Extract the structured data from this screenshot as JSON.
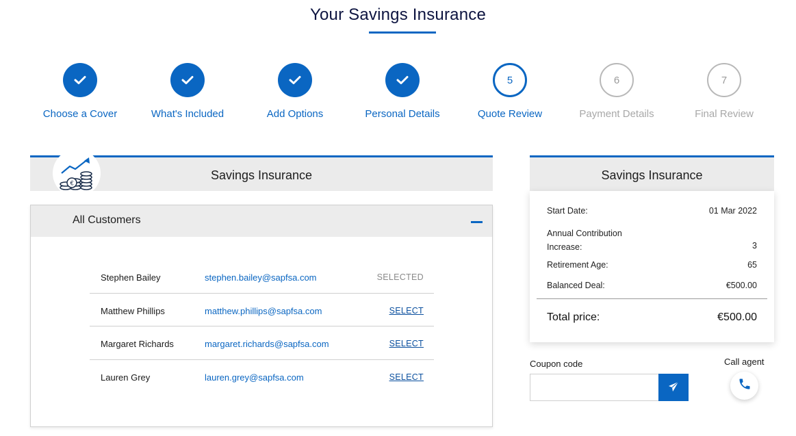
{
  "page": {
    "title": "Your Savings Insurance"
  },
  "stepper": {
    "steps": [
      {
        "number": "1",
        "label": "Choose a Cover",
        "state": "done"
      },
      {
        "number": "2",
        "label": "What's Included",
        "state": "done"
      },
      {
        "number": "3",
        "label": "Add Options",
        "state": "done"
      },
      {
        "number": "4",
        "label": "Personal Details",
        "state": "done"
      },
      {
        "number": "5",
        "label": "Quote Review",
        "state": "current"
      },
      {
        "number": "6",
        "label": "Payment Details",
        "state": "todo"
      },
      {
        "number": "7",
        "label": "Final Review",
        "state": "todo"
      }
    ]
  },
  "product": {
    "title": "Savings Insurance",
    "icon": "savings-growth-icon"
  },
  "customers": {
    "title": "All Customers",
    "rows": [
      {
        "name": "Stephen Bailey",
        "email": "stephen.bailey@sapfsa.com",
        "action": "SELECTED",
        "selected": true
      },
      {
        "name": "Matthew Phillips",
        "email": "matthew.phillips@sapfsa.com",
        "action": "SELECT",
        "selected": false
      },
      {
        "name": "Margaret Richards",
        "email": "margaret.richards@sapfsa.com",
        "action": "SELECT",
        "selected": false
      },
      {
        "name": "Lauren Grey",
        "email": "lauren.grey@sapfsa.com",
        "action": "SELECT",
        "selected": false
      }
    ]
  },
  "summary": {
    "title": "Savings Insurance",
    "start_date_label": "Start Date:",
    "start_date_value": "01 Mar 2022",
    "annual_label_line1": "Annual Contribution",
    "annual_label_line2": "Increase:",
    "annual_value": "3",
    "retirement_label": "Retirement Age:",
    "retirement_value": "65",
    "balanced_label": "Balanced Deal:",
    "balanced_value": "€500.00",
    "total_label": "Total price:",
    "total_value": "€500.00"
  },
  "coupon": {
    "label": "Coupon code",
    "value": "",
    "placeholder": ""
  },
  "call": {
    "label": "Call agent"
  },
  "colors": {
    "accent": "#0a66c2",
    "muted": "#a8a8a8",
    "panel": "#ebebeb"
  }
}
